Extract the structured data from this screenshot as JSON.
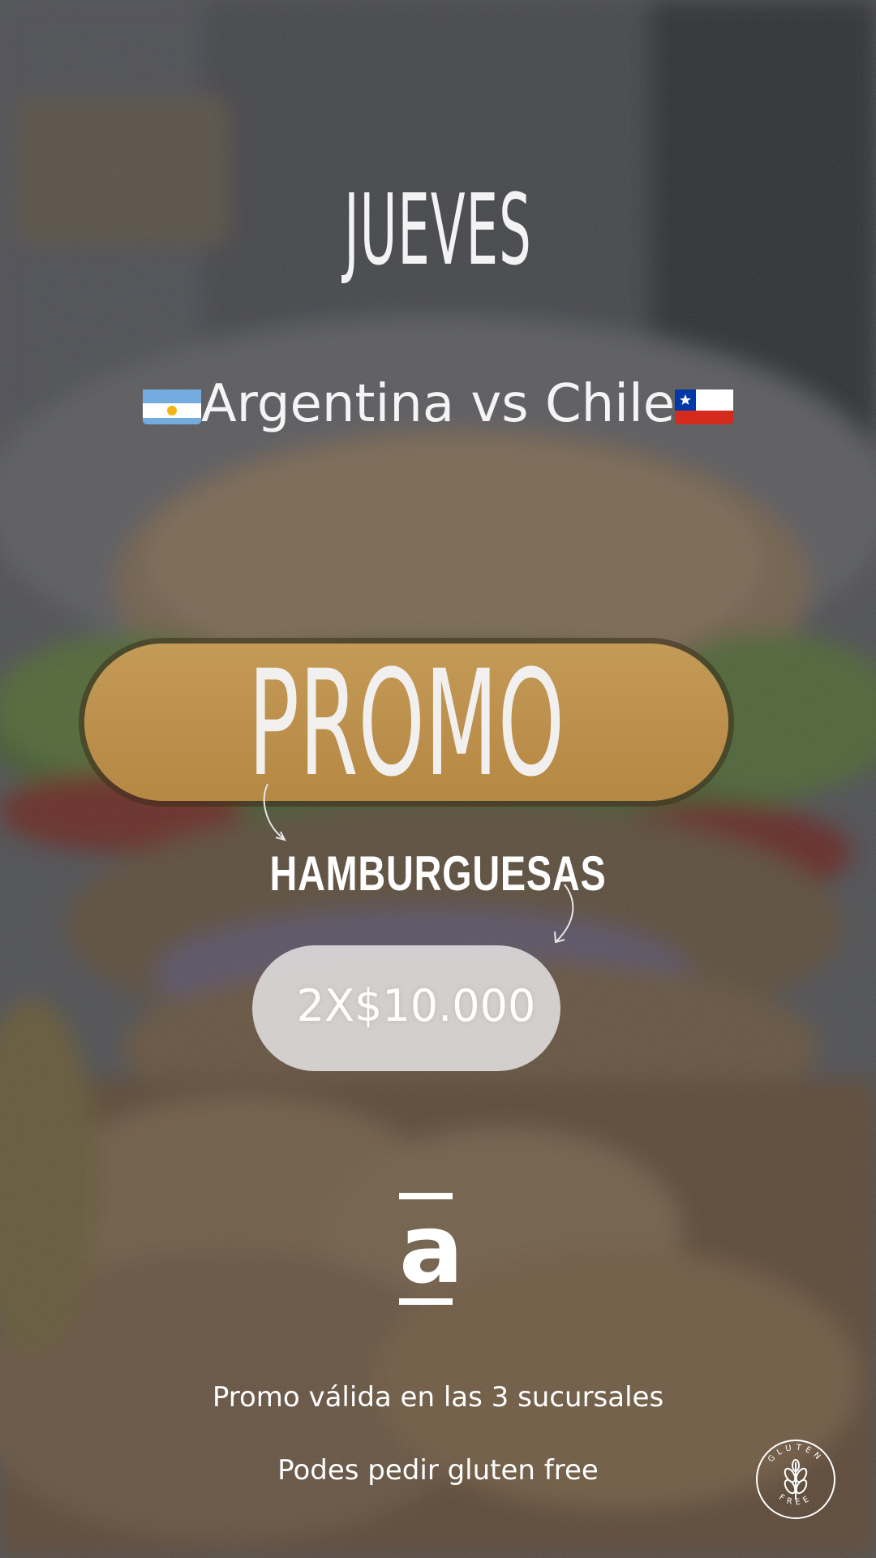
{
  "colors": {
    "promo_pill": "#bf934e",
    "price_pill": "#dedcdc",
    "text": "#ffffff"
  },
  "heading": "JUEVES",
  "match": {
    "home": "Argentina",
    "vs": "vs",
    "away": "Chile",
    "home_flag_icon": "argentina-flag-icon",
    "away_flag_icon": "chile-flag-icon"
  },
  "promo": {
    "label": "PROMO",
    "product": "HAMBURGUESAS",
    "price": "2X$10.000"
  },
  "logo": {
    "letter": "a"
  },
  "notes": {
    "branches": "Promo válida en las 3 sucursales",
    "gluten": "Podes pedir gluten free"
  },
  "badge": {
    "icon": "gluten-free-badge-icon",
    "text": "GLUTEN FREE"
  }
}
